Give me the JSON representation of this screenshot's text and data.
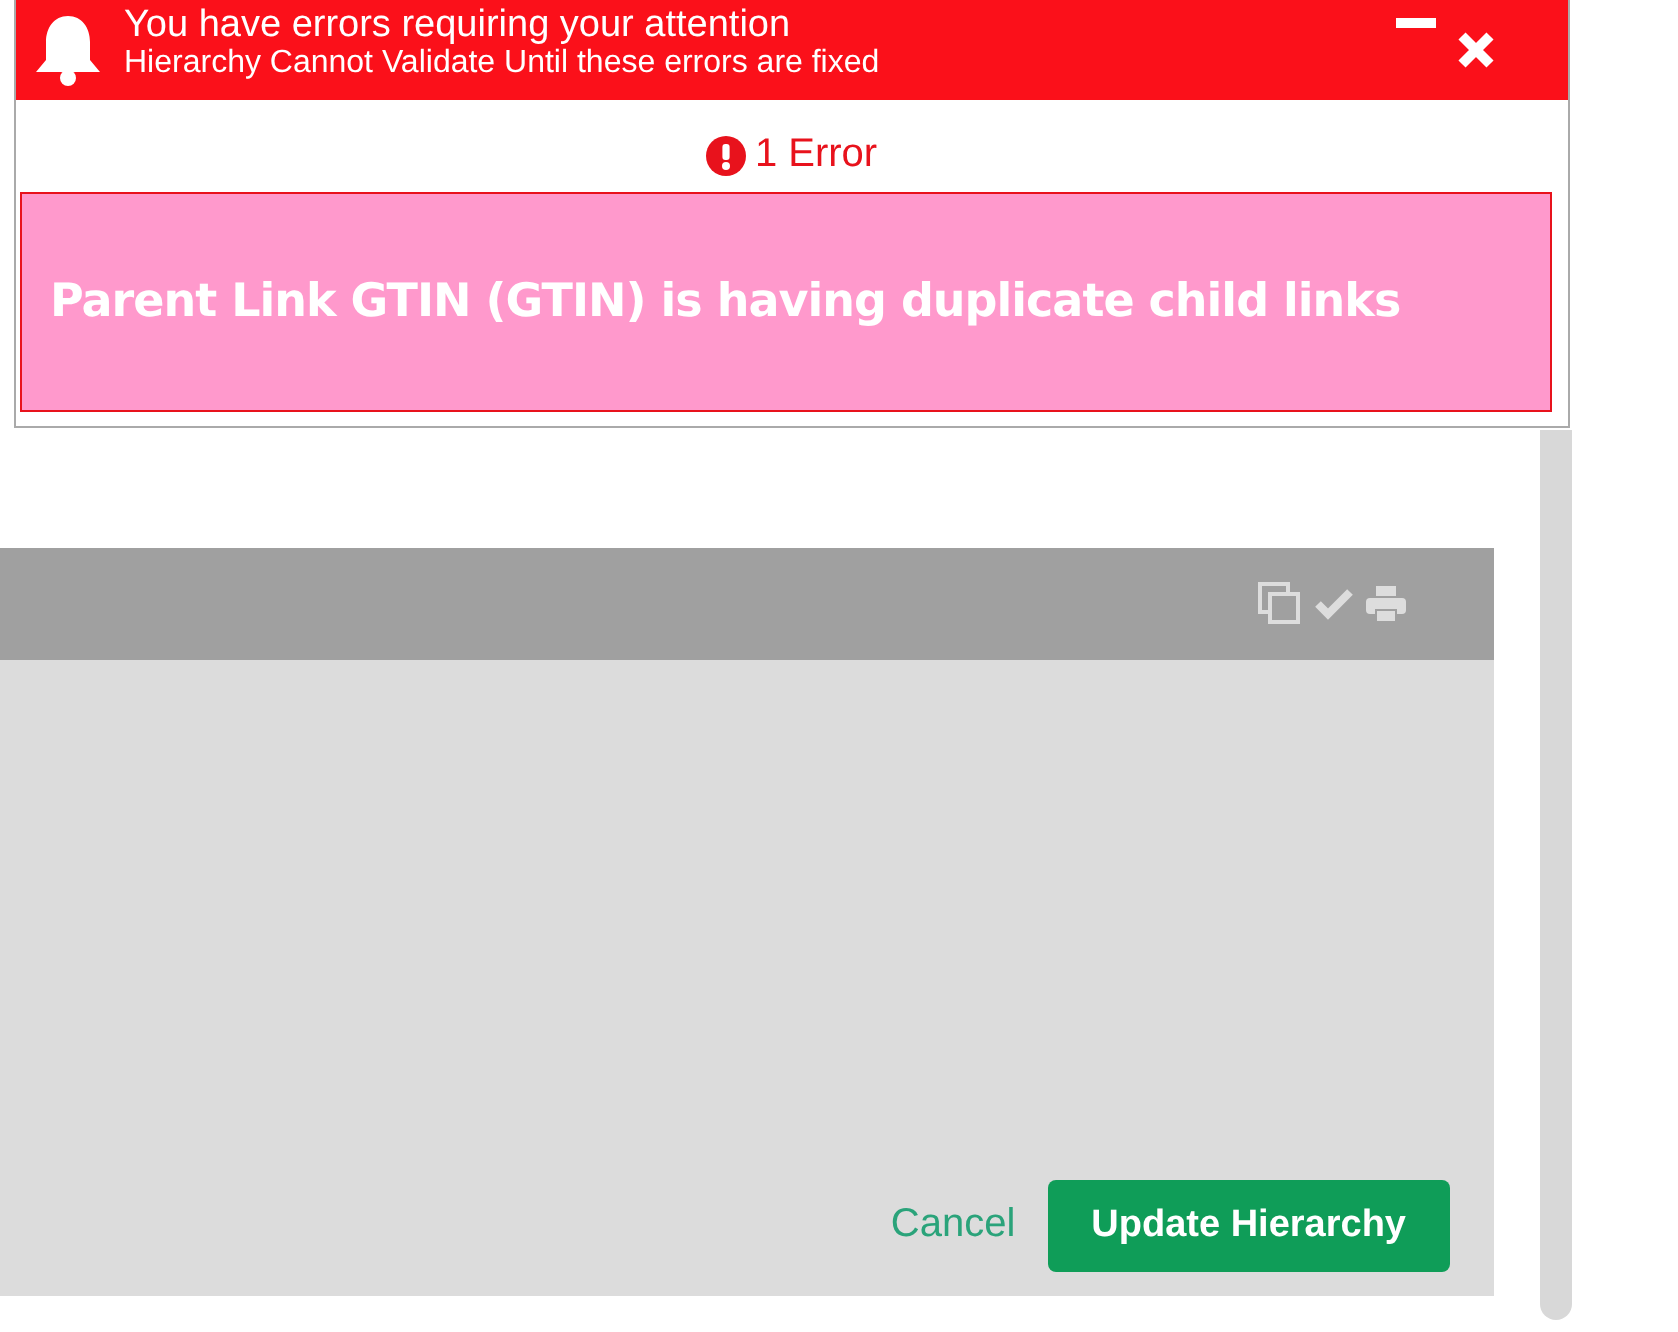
{
  "notification": {
    "title": "You have errors requiring your attention",
    "subtitle": "Hierarchy Cannot Validate Until these errors are fixed",
    "error_count": "1 Error",
    "errors": [
      {
        "message": "Parent Link GTIN (GTIN) is having duplicate child links"
      }
    ]
  },
  "actions": {
    "cancel": "Cancel",
    "submit": "Update Hierarchy"
  }
}
